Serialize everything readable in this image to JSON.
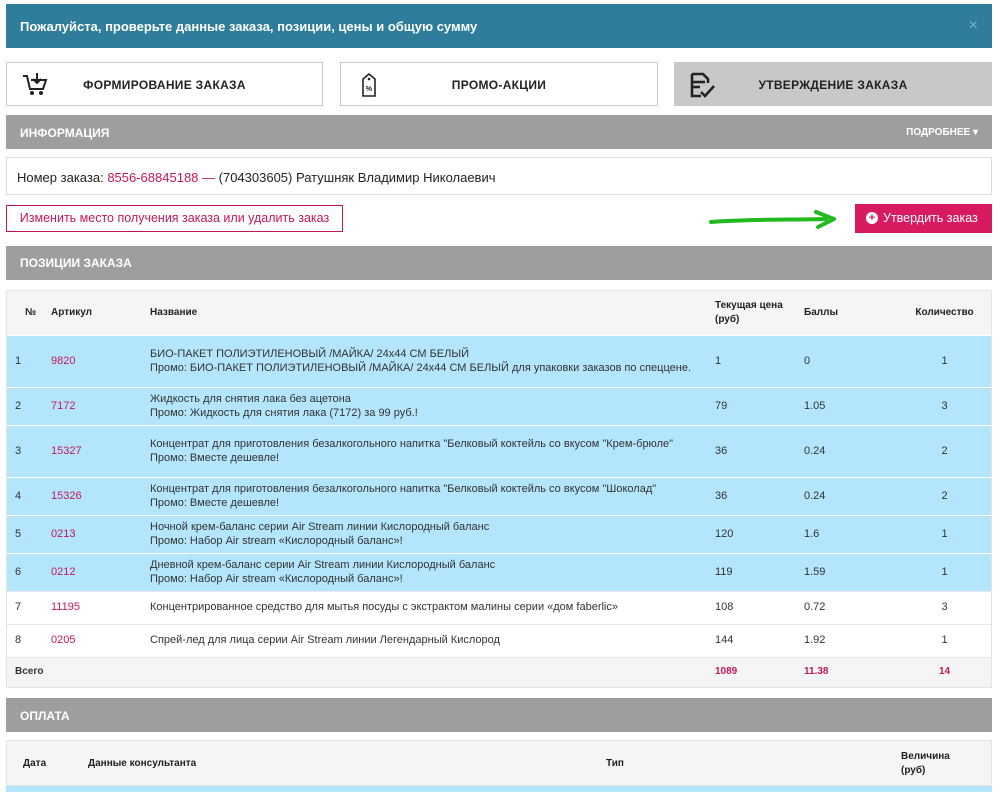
{
  "alert": {
    "text": "Пожалуйста, проверьте данные заказа, позиции, цены и общую сумму",
    "close": "×"
  },
  "steps": [
    {
      "label": "ФОРМИРОВАНИЕ ЗАКАЗА",
      "icon": "cart-add-icon"
    },
    {
      "label": "ПРОМО-АКЦИИ",
      "icon": "price-tag-icon",
      "tag_text": "%"
    },
    {
      "label": "УТВЕРЖДЕНИЕ ЗАКАЗА",
      "icon": "document-check-icon"
    }
  ],
  "info": {
    "title": "ИНФОРМАЦИЯ",
    "more": "ПОДРОБНЕЕ ▾"
  },
  "order": {
    "label": "Номер заказа:",
    "number": "8556-68845188 —",
    "details": "(704303605) Ратушняк Владимир Николаевич"
  },
  "actions": {
    "change": "Изменить место получения заказа или удалить заказ",
    "confirm": "Утвердить заказ",
    "confirm_icon": "+"
  },
  "positions": {
    "title": "ПОЗИЦИИ ЗАКАЗА",
    "columns": [
      "№",
      "Артикул",
      "Название",
      "Текущая цена (руб)",
      "Баллы",
      "Количество"
    ],
    "rows": [
      {
        "n": "1",
        "art": "9820",
        "name": [
          "БИО-ПАКЕТ ПОЛИЭТИЛЕНОВЫЙ /МАЙКА/ 24x44 СМ БЕЛЫЙ",
          "Промо: БИО-ПАКЕТ ПОЛИЭТИЛЕНОВЫЙ /МАЙКА/ 24x44 СМ БЕЛЫЙ для упаковки заказов по спеццене."
        ],
        "price": "1",
        "points": "0",
        "qty": "1",
        "promo": true
      },
      {
        "n": "2",
        "art": "7172",
        "name": [
          "Жидкость для снятия лака без ацетона",
          "Промо: Жидкость для снятия лака (7172) за 99 руб.!"
        ],
        "price": "79",
        "points": "1.05",
        "qty": "3",
        "promo": true
      },
      {
        "n": "3",
        "art": "15327",
        "name": [
          "Концентрат для приготовления безалкогольного напитка \"Белковый коктейль со вкусом \"Крем-брюле\"",
          "Промо: Вместе дешевле!"
        ],
        "price": "36",
        "points": "0.24",
        "qty": "2",
        "promo": true
      },
      {
        "n": "4",
        "art": "15326",
        "name": [
          "Концентрат для приготовления безалкогольного напитка \"Белковый коктейль со вкусом \"Шоколад\"",
          "Промо: Вместе дешевле!"
        ],
        "price": "36",
        "points": "0.24",
        "qty": "2",
        "promo": true
      },
      {
        "n": "5",
        "art": "0213",
        "name": [
          "Ночной крем-баланс серии Air Stream линии Кислородный баланс",
          "Промо: Набор Air stream «Кислородный баланс»!"
        ],
        "price": "120",
        "points": "1.6",
        "qty": "1",
        "promo": true
      },
      {
        "n": "6",
        "art": "0212",
        "name": [
          "Дневной крем-баланс серии Air Stream линии Кислородный баланс",
          "Промо: Набор Air stream «Кислородный баланс»!"
        ],
        "price": "119",
        "points": "1.59",
        "qty": "1",
        "promo": true
      },
      {
        "n": "7",
        "art": "11195",
        "name": [
          "Концентрированное средство для мытья посуды с экстрактом малины серии «дом faberlic»"
        ],
        "price": "108",
        "points": "0.72",
        "qty": "3",
        "promo": false
      },
      {
        "n": "8",
        "art": "0205",
        "name": [
          "Спрей-лед для лица серии Air Stream линии Легендарный Кислород"
        ],
        "price": "144",
        "points": "1.92",
        "qty": "1",
        "promo": false
      }
    ],
    "total": {
      "label": "Всего",
      "price": "1089",
      "points": "11.38",
      "qty": "14"
    }
  },
  "payment": {
    "title": "ОПЛАТА",
    "columns": [
      "Дата",
      "Данные консультанта",
      "Тип",
      "Величина",
      "(руб)"
    ]
  },
  "colors": {
    "alert": "#2e7d9a",
    "accent": "#d81b60",
    "highlight": "#b3e5fc",
    "bar": "#9e9e9e",
    "arrow": "#22b81e"
  }
}
